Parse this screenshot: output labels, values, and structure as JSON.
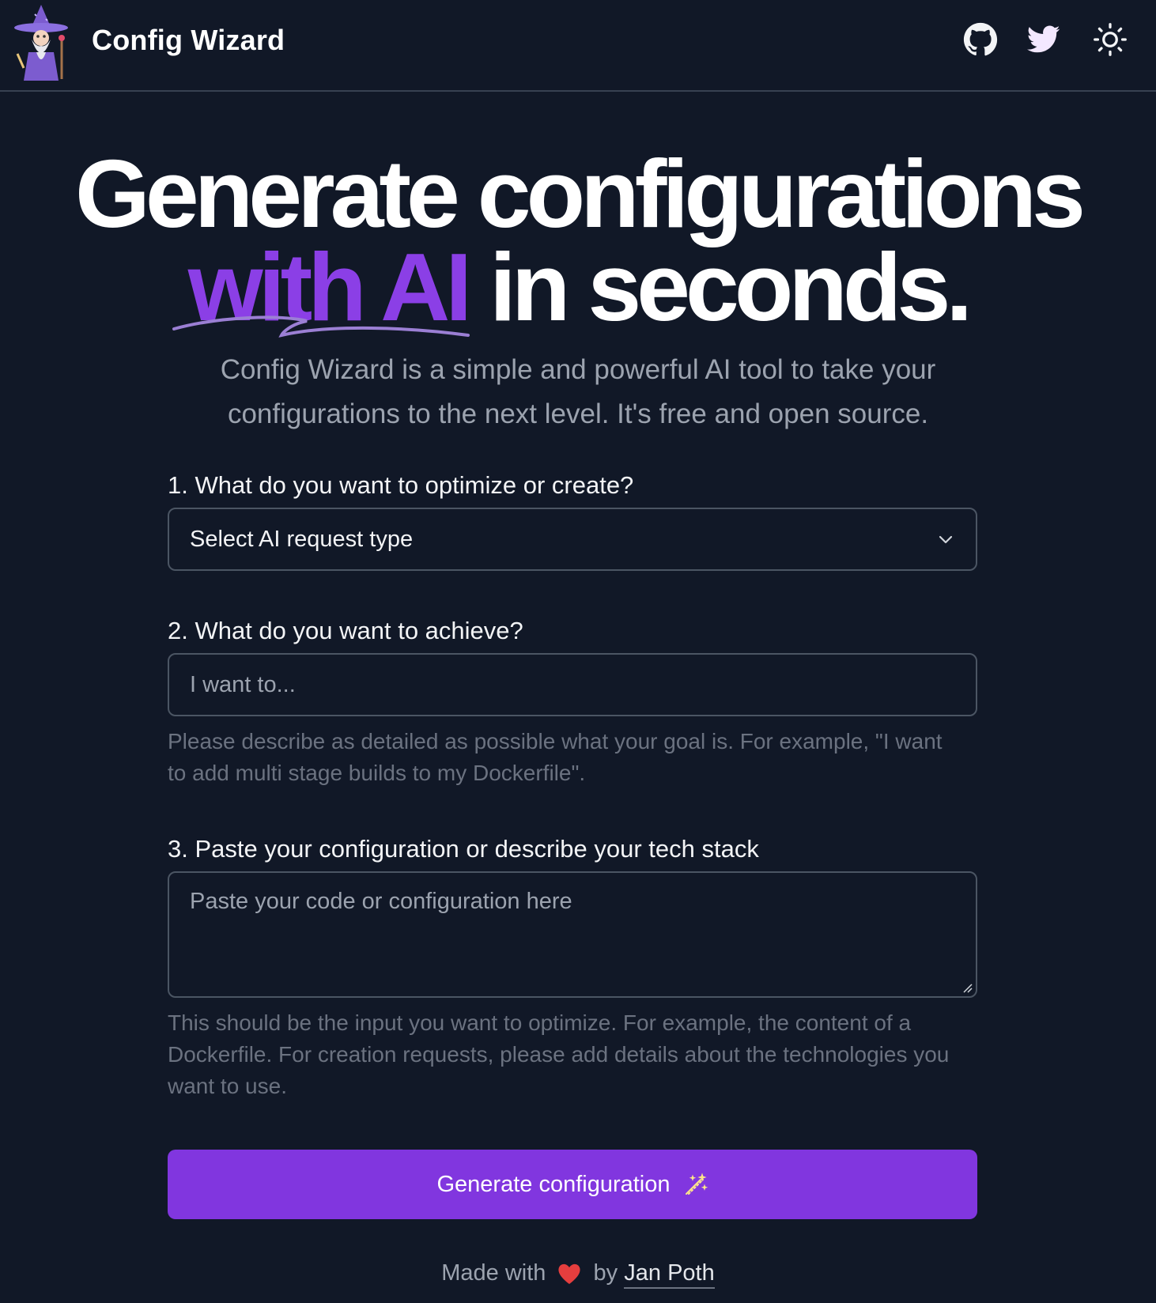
{
  "header": {
    "brand": "Config Wizard",
    "icons": [
      "wizard-logo",
      "github-icon",
      "twitter-icon",
      "sun-icon"
    ]
  },
  "hero": {
    "line1": "Generate configurations",
    "accent": "with AI",
    "rest": " in seconds."
  },
  "subtitle": "Config Wizard is a simple and powerful AI tool to take your configurations to the next level. It's free and open source.",
  "form": {
    "q1_label": "1. What do you want to optimize or create?",
    "q1_select_value": "Select AI request type",
    "q2_label": "2. What do you want to achieve?",
    "q2_placeholder": "I want to...",
    "q2_help": "Please describe as detailed as possible what your goal is. For example, \"I want to add multi stage builds to my Dockerfile\".",
    "q3_label": "3. Paste your configuration or describe your tech stack",
    "q3_placeholder": "Paste your code or configuration here",
    "q3_help": "This should be the input you want to optimize. For example, the content of a Dockerfile. For creation requests, please add details about the technologies you want to use.",
    "submit_label": "Generate configuration"
  },
  "footer": {
    "made_with": "Made with",
    "by": "by",
    "author": "Jan Poth"
  },
  "colors": {
    "background": "#111827",
    "accent": "#8b3fe6",
    "button": "#8136df",
    "heart": "#e53e3e"
  }
}
